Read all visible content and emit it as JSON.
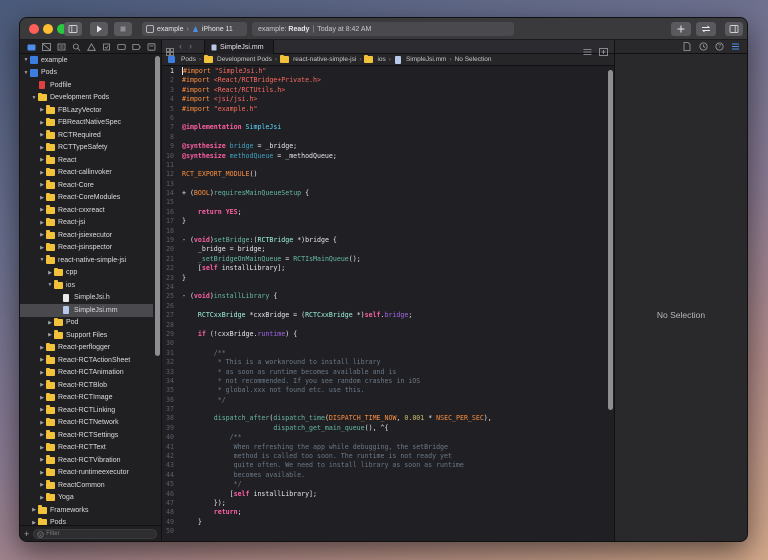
{
  "toolbar": {
    "scheme_target": "example",
    "device": "iPhone 11",
    "status_target": "example",
    "status_state": "Ready",
    "status_time": "Today at 8:42 AM",
    "status_sep": "|"
  },
  "navigator": {
    "filter_placeholder": "Filter",
    "items": [
      {
        "label": "example",
        "indent": 0,
        "icon": "proj",
        "disclosure": "open"
      },
      {
        "label": "Pods",
        "indent": 0,
        "icon": "proj",
        "disclosure": "open"
      },
      {
        "label": "Podfile",
        "indent": 1,
        "icon": "pod",
        "disclosure": "none"
      },
      {
        "label": "Development Pods",
        "indent": 1,
        "icon": "folder",
        "disclosure": "open"
      },
      {
        "label": "FBLazyVector",
        "indent": 2,
        "icon": "folder",
        "disclosure": "closed"
      },
      {
        "label": "FBReactNativeSpec",
        "indent": 2,
        "icon": "folder",
        "disclosure": "closed"
      },
      {
        "label": "RCTRequired",
        "indent": 2,
        "icon": "folder",
        "disclosure": "closed"
      },
      {
        "label": "RCTTypeSafety",
        "indent": 2,
        "icon": "folder",
        "disclosure": "closed"
      },
      {
        "label": "React",
        "indent": 2,
        "icon": "folder",
        "disclosure": "closed"
      },
      {
        "label": "React-callinvoker",
        "indent": 2,
        "icon": "folder",
        "disclosure": "closed"
      },
      {
        "label": "React-Core",
        "indent": 2,
        "icon": "folder",
        "disclosure": "closed"
      },
      {
        "label": "React-CoreModules",
        "indent": 2,
        "icon": "folder",
        "disclosure": "closed"
      },
      {
        "label": "React-cxxreact",
        "indent": 2,
        "icon": "folder",
        "disclosure": "closed"
      },
      {
        "label": "React-jsi",
        "indent": 2,
        "icon": "folder",
        "disclosure": "closed"
      },
      {
        "label": "React-jsiexecutor",
        "indent": 2,
        "icon": "folder",
        "disclosure": "closed"
      },
      {
        "label": "React-jsinspector",
        "indent": 2,
        "icon": "folder",
        "disclosure": "closed"
      },
      {
        "label": "react-native-simple-jsi",
        "indent": 2,
        "icon": "folder",
        "disclosure": "open"
      },
      {
        "label": "cpp",
        "indent": 3,
        "icon": "folder",
        "disclosure": "closed"
      },
      {
        "label": "ios",
        "indent": 3,
        "icon": "folder",
        "disclosure": "open"
      },
      {
        "label": "SimpleJsi.h",
        "indent": 4,
        "icon": "h",
        "disclosure": "none"
      },
      {
        "label": "SimpleJsi.mm",
        "indent": 4,
        "icon": "mm",
        "disclosure": "none",
        "selected": true
      },
      {
        "label": "Pod",
        "indent": 3,
        "icon": "folder",
        "disclosure": "closed"
      },
      {
        "label": "Support Files",
        "indent": 3,
        "icon": "folder",
        "disclosure": "closed"
      },
      {
        "label": "React-perflogger",
        "indent": 2,
        "icon": "folder",
        "disclosure": "closed"
      },
      {
        "label": "React-RCTActionSheet",
        "indent": 2,
        "icon": "folder",
        "disclosure": "closed"
      },
      {
        "label": "React-RCTAnimation",
        "indent": 2,
        "icon": "folder",
        "disclosure": "closed"
      },
      {
        "label": "React-RCTBlob",
        "indent": 2,
        "icon": "folder",
        "disclosure": "closed"
      },
      {
        "label": "React-RCTImage",
        "indent": 2,
        "icon": "folder",
        "disclosure": "closed"
      },
      {
        "label": "React-RCTLinking",
        "indent": 2,
        "icon": "folder",
        "disclosure": "closed"
      },
      {
        "label": "React-RCTNetwork",
        "indent": 2,
        "icon": "folder",
        "disclosure": "closed"
      },
      {
        "label": "React-RCTSettings",
        "indent": 2,
        "icon": "folder",
        "disclosure": "closed"
      },
      {
        "label": "React-RCTText",
        "indent": 2,
        "icon": "folder",
        "disclosure": "closed"
      },
      {
        "label": "React-RCTVibration",
        "indent": 2,
        "icon": "folder",
        "disclosure": "closed"
      },
      {
        "label": "React-runtimeexecutor",
        "indent": 2,
        "icon": "folder",
        "disclosure": "closed"
      },
      {
        "label": "ReactCommon",
        "indent": 2,
        "icon": "folder",
        "disclosure": "closed"
      },
      {
        "label": "Yoga",
        "indent": 2,
        "icon": "folder",
        "disclosure": "closed"
      },
      {
        "label": "Frameworks",
        "indent": 1,
        "icon": "folder",
        "disclosure": "closed"
      },
      {
        "label": "Pods",
        "indent": 1,
        "icon": "folder",
        "disclosure": "closed"
      }
    ]
  },
  "editor": {
    "tab_label": "SimpleJsi.mm",
    "breadcrumbs": [
      "Pods",
      "Development Pods",
      "react-native-simple-jsi",
      "ios",
      "SimpleJsi.mm",
      "No Selection"
    ],
    "lines": [
      {
        "n": "1",
        "cur": true,
        "segs": [
          [
            "pp",
            "#import "
          ],
          [
            "str",
            "\"SimpleJsi.h\""
          ]
        ]
      },
      {
        "n": "2",
        "segs": [
          [
            "pp",
            "#import "
          ],
          [
            "str",
            "<React/RCTBridge+Private.h>"
          ]
        ]
      },
      {
        "n": "3",
        "segs": [
          [
            "pp",
            "#import "
          ],
          [
            "str",
            "<React/RCTUtils.h>"
          ]
        ]
      },
      {
        "n": "4",
        "segs": [
          [
            "pp",
            "#import "
          ],
          [
            "str",
            "<jsi/jsi.h>"
          ]
        ]
      },
      {
        "n": "5",
        "segs": [
          [
            "pp",
            "#import "
          ],
          [
            "str",
            "\"example.h\""
          ]
        ]
      },
      {
        "n": "6",
        "segs": []
      },
      {
        "n": "7",
        "segs": [
          [
            "kw",
            "@implementation "
          ],
          [
            "ty",
            "SimpleJsi"
          ]
        ]
      },
      {
        "n": "8",
        "segs": []
      },
      {
        "n": "9",
        "segs": [
          [
            "kw",
            "@synthesize "
          ],
          [
            "var",
            "bridge"
          ],
          [
            "tx",
            " = _bridge;"
          ]
        ]
      },
      {
        "n": "10",
        "segs": [
          [
            "kw",
            "@synthesize "
          ],
          [
            "var",
            "methodQueue"
          ],
          [
            "tx",
            " = _methodQueue;"
          ]
        ]
      },
      {
        "n": "11",
        "segs": []
      },
      {
        "n": "12",
        "segs": [
          [
            "mac",
            "RCT_EXPORT_MODULE"
          ],
          [
            "tx",
            "()"
          ]
        ]
      },
      {
        "n": "13",
        "segs": []
      },
      {
        "n": "14",
        "segs": [
          [
            "tx",
            "+ ("
          ],
          [
            "mac",
            "BOOL"
          ],
          [
            "tx",
            ")"
          ],
          [
            "fn",
            "requiresMainQueueSetup"
          ],
          [
            "tx",
            " {"
          ]
        ]
      },
      {
        "n": "15",
        "segs": []
      },
      {
        "n": "16",
        "segs": [
          [
            "tx",
            "    "
          ],
          [
            "kw",
            "return "
          ],
          [
            "kw",
            "YES"
          ],
          [
            "tx",
            ";"
          ]
        ]
      },
      {
        "n": "17",
        "segs": [
          [
            "tx",
            "}"
          ]
        ]
      },
      {
        "n": "18",
        "segs": []
      },
      {
        "n": "19",
        "segs": [
          [
            "tx",
            "- ("
          ],
          [
            "kw",
            "void"
          ],
          [
            "tx",
            ")"
          ],
          [
            "fn",
            "setBridge"
          ],
          [
            "tx",
            ":("
          ],
          [
            "cls",
            "RCTBridge"
          ],
          [
            "tx",
            " *)bridge {"
          ]
        ]
      },
      {
        "n": "20",
        "segs": [
          [
            "tx",
            "    _bridge = bridge;"
          ]
        ]
      },
      {
        "n": "21",
        "segs": [
          [
            "tx",
            "    "
          ],
          [
            "fn",
            "_setBridgeOnMainQueue"
          ],
          [
            "tx",
            " = "
          ],
          [
            "fn",
            "RCTIsMainQueue"
          ],
          [
            "tx",
            "();"
          ]
        ]
      },
      {
        "n": "22",
        "segs": [
          [
            "tx",
            "    ["
          ],
          [
            "kw",
            "self"
          ],
          [
            "tx",
            " installLibrary];"
          ]
        ]
      },
      {
        "n": "23",
        "segs": [
          [
            "tx",
            "}"
          ]
        ]
      },
      {
        "n": "24",
        "segs": []
      },
      {
        "n": "25",
        "segs": [
          [
            "tx",
            "- ("
          ],
          [
            "kw",
            "void"
          ],
          [
            "tx",
            ")"
          ],
          [
            "fn",
            "installLibrary"
          ],
          [
            "tx",
            " {"
          ]
        ]
      },
      {
        "n": "26",
        "segs": []
      },
      {
        "n": "27",
        "segs": [
          [
            "tx",
            "    "
          ],
          [
            "cls",
            "RCTCxxBridge"
          ],
          [
            "tx",
            " *cxxBridge = ("
          ],
          [
            "cls",
            "RCTCxxBridge"
          ],
          [
            "tx",
            " *)"
          ],
          [
            "kw",
            "self"
          ],
          [
            "tx",
            "."
          ],
          [
            "prop",
            "bridge"
          ],
          [
            "tx",
            ";"
          ]
        ]
      },
      {
        "n": "28",
        "segs": []
      },
      {
        "n": "29",
        "segs": [
          [
            "tx",
            "    "
          ],
          [
            "kw",
            "if"
          ],
          [
            "tx",
            " (!cxxBridge."
          ],
          [
            "prop",
            "runtime"
          ],
          [
            "tx",
            ") {"
          ]
        ]
      },
      {
        "n": "30",
        "segs": []
      },
      {
        "n": "31",
        "segs": [
          [
            "cm",
            "        /**"
          ]
        ]
      },
      {
        "n": "32",
        "segs": [
          [
            "cm",
            "         * This is a workaround to install library"
          ]
        ]
      },
      {
        "n": "33",
        "segs": [
          [
            "cm",
            "         * as soon as runtime becomes available and is"
          ]
        ]
      },
      {
        "n": "34",
        "segs": [
          [
            "cm",
            "         * not recommended. If you see random crashes in iOS"
          ]
        ]
      },
      {
        "n": "35",
        "segs": [
          [
            "cm",
            "         * global.xxx not found etc. use this."
          ]
        ]
      },
      {
        "n": "36",
        "segs": [
          [
            "cm",
            "         */"
          ]
        ]
      },
      {
        "n": "37",
        "segs": []
      },
      {
        "n": "38",
        "segs": [
          [
            "tx",
            "        "
          ],
          [
            "fn",
            "dispatch_after"
          ],
          [
            "tx",
            "("
          ],
          [
            "fn",
            "dispatch_time"
          ],
          [
            "tx",
            "("
          ],
          [
            "mac",
            "DISPATCH_TIME_NOW"
          ],
          [
            "tx",
            ", "
          ],
          [
            "num",
            "0.001"
          ],
          [
            "tx",
            " * "
          ],
          [
            "mac",
            "NSEC_PER_SEC"
          ],
          [
            "tx",
            "),"
          ]
        ]
      },
      {
        "n": "39",
        "segs": [
          [
            "tx",
            "                       "
          ],
          [
            "fn",
            "dispatch_get_main_queue"
          ],
          [
            "tx",
            "(), ^{"
          ]
        ]
      },
      {
        "n": "40",
        "segs": [
          [
            "cm",
            "            /**"
          ]
        ]
      },
      {
        "n": "41",
        "segs": [
          [
            "cm",
            "             When refreshing the app while debugging, the setBridge"
          ]
        ]
      },
      {
        "n": "42",
        "segs": [
          [
            "cm",
            "             method is called too soon. The runtime is not ready yet"
          ]
        ]
      },
      {
        "n": "43",
        "segs": [
          [
            "cm",
            "             quite often. We need to install library as soon as runtime"
          ]
        ]
      },
      {
        "n": "44",
        "segs": [
          [
            "cm",
            "             becomes available."
          ]
        ]
      },
      {
        "n": "45",
        "segs": [
          [
            "cm",
            "             */"
          ]
        ]
      },
      {
        "n": "46",
        "segs": [
          [
            "tx",
            "            ["
          ],
          [
            "kw",
            "self"
          ],
          [
            "tx",
            " installLibrary];"
          ]
        ]
      },
      {
        "n": "47",
        "segs": [
          [
            "tx",
            "        });"
          ]
        ]
      },
      {
        "n": "48",
        "segs": [
          [
            "tx",
            "        "
          ],
          [
            "kw",
            "return"
          ],
          [
            "tx",
            ";"
          ]
        ]
      },
      {
        "n": "49",
        "segs": [
          [
            "tx",
            "    }"
          ]
        ]
      },
      {
        "n": "50",
        "segs": []
      }
    ]
  },
  "inspector": {
    "empty_label": "No Selection"
  }
}
